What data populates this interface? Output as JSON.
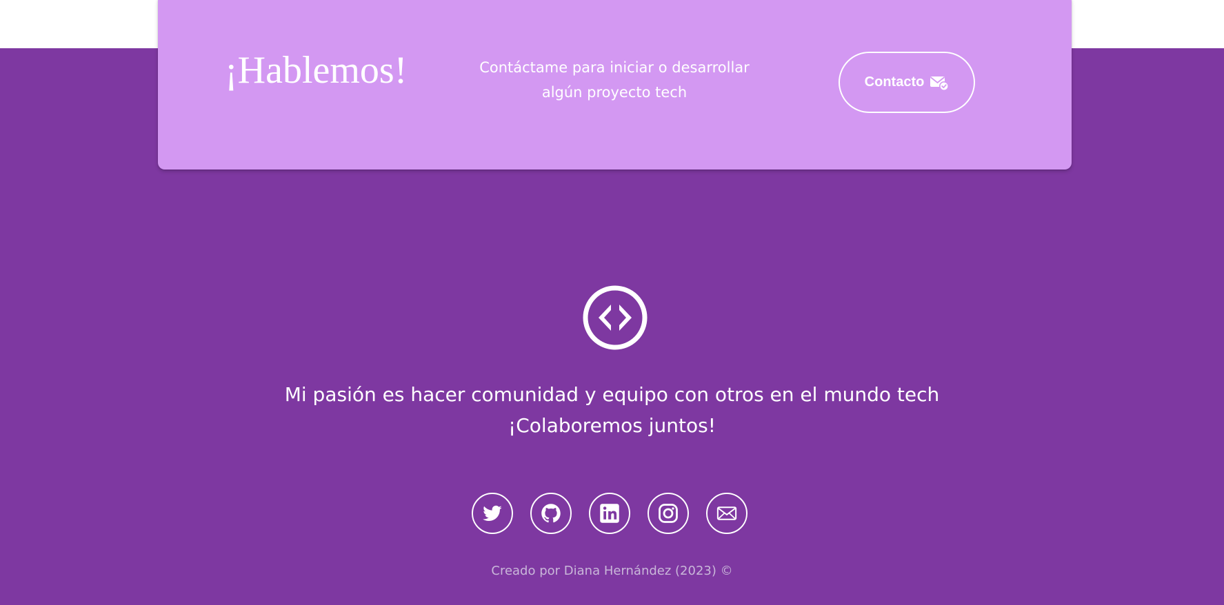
{
  "colors": {
    "footer_background": "#7e38a1",
    "card_background": "#d398f2",
    "text": "#ffffff",
    "credits_text": "#c9b7d9",
    "page_background": "#ffffff"
  },
  "cta": {
    "title": "¡Hablemos!",
    "description": "Contáctame para iniciar o desarrollar algún proyecto tech",
    "button_label": "Contacto",
    "button_icon": "mail-check-icon"
  },
  "footer": {
    "logo_icon": "code-brackets-circle-icon",
    "tagline_line1": "Mi pasión es hacer comunidad y equipo con otros en el mundo tech",
    "tagline_line2": "¡Colaboremos juntos!",
    "socials": [
      {
        "name": "twitter",
        "icon": "twitter-icon"
      },
      {
        "name": "github",
        "icon": "github-icon"
      },
      {
        "name": "linkedin",
        "icon": "linkedin-icon"
      },
      {
        "name": "instagram",
        "icon": "instagram-icon"
      },
      {
        "name": "email",
        "icon": "envelope-icon"
      }
    ],
    "credits": "Creado por Diana Hernández (2023) ©"
  }
}
